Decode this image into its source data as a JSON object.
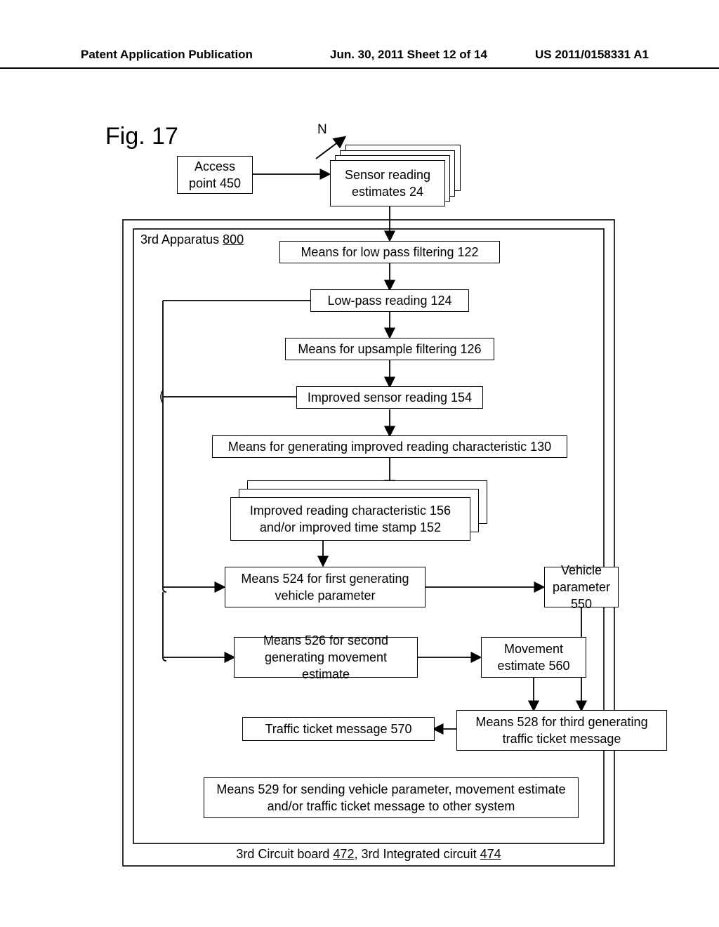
{
  "header": {
    "left": "Patent Application Publication",
    "middle": "Jun. 30, 2011  Sheet 12 of 14",
    "right": "US 2011/0158331 A1"
  },
  "figure_label": "Fig. 17",
  "n_label": "N",
  "apparatus": {
    "label_prefix": "3rd Apparatus ",
    "label_num": "800"
  },
  "boxes": {
    "access_point": "Access\npoint 450",
    "sensor_reading": "Sensor reading\nestimates 24",
    "lowpass_filter": "Means for low pass filtering 122",
    "lowpass_reading": "Low-pass reading 124",
    "upsample": "Means for upsample filtering 126",
    "improved_sr": "Improved sensor reading 154",
    "gen_irc": "Means for generating improved reading characteristic 130",
    "irc": "Improved reading characteristic 156\nand/or improved time stamp 152",
    "means_524": "Means 524 for first generating\nvehicle parameter",
    "veh_param": "Vehicle\nparameter 550",
    "means_526": "Means 526 for second\ngenerating movement estimate",
    "move_est": "Movement\nestimate 560",
    "ticket_msg": "Traffic ticket message 570",
    "means_528": "Means 528 for third generating\ntraffic ticket message",
    "means_529": "Means 529 for sending vehicle parameter, movement estimate\nand/or traffic ticket message to other system"
  },
  "footer": {
    "cb_prefix": "3rd Circuit board ",
    "cb_num": "472",
    "sep": ", ",
    "ic_prefix": "3rd Integrated circuit ",
    "ic_num": "474"
  }
}
